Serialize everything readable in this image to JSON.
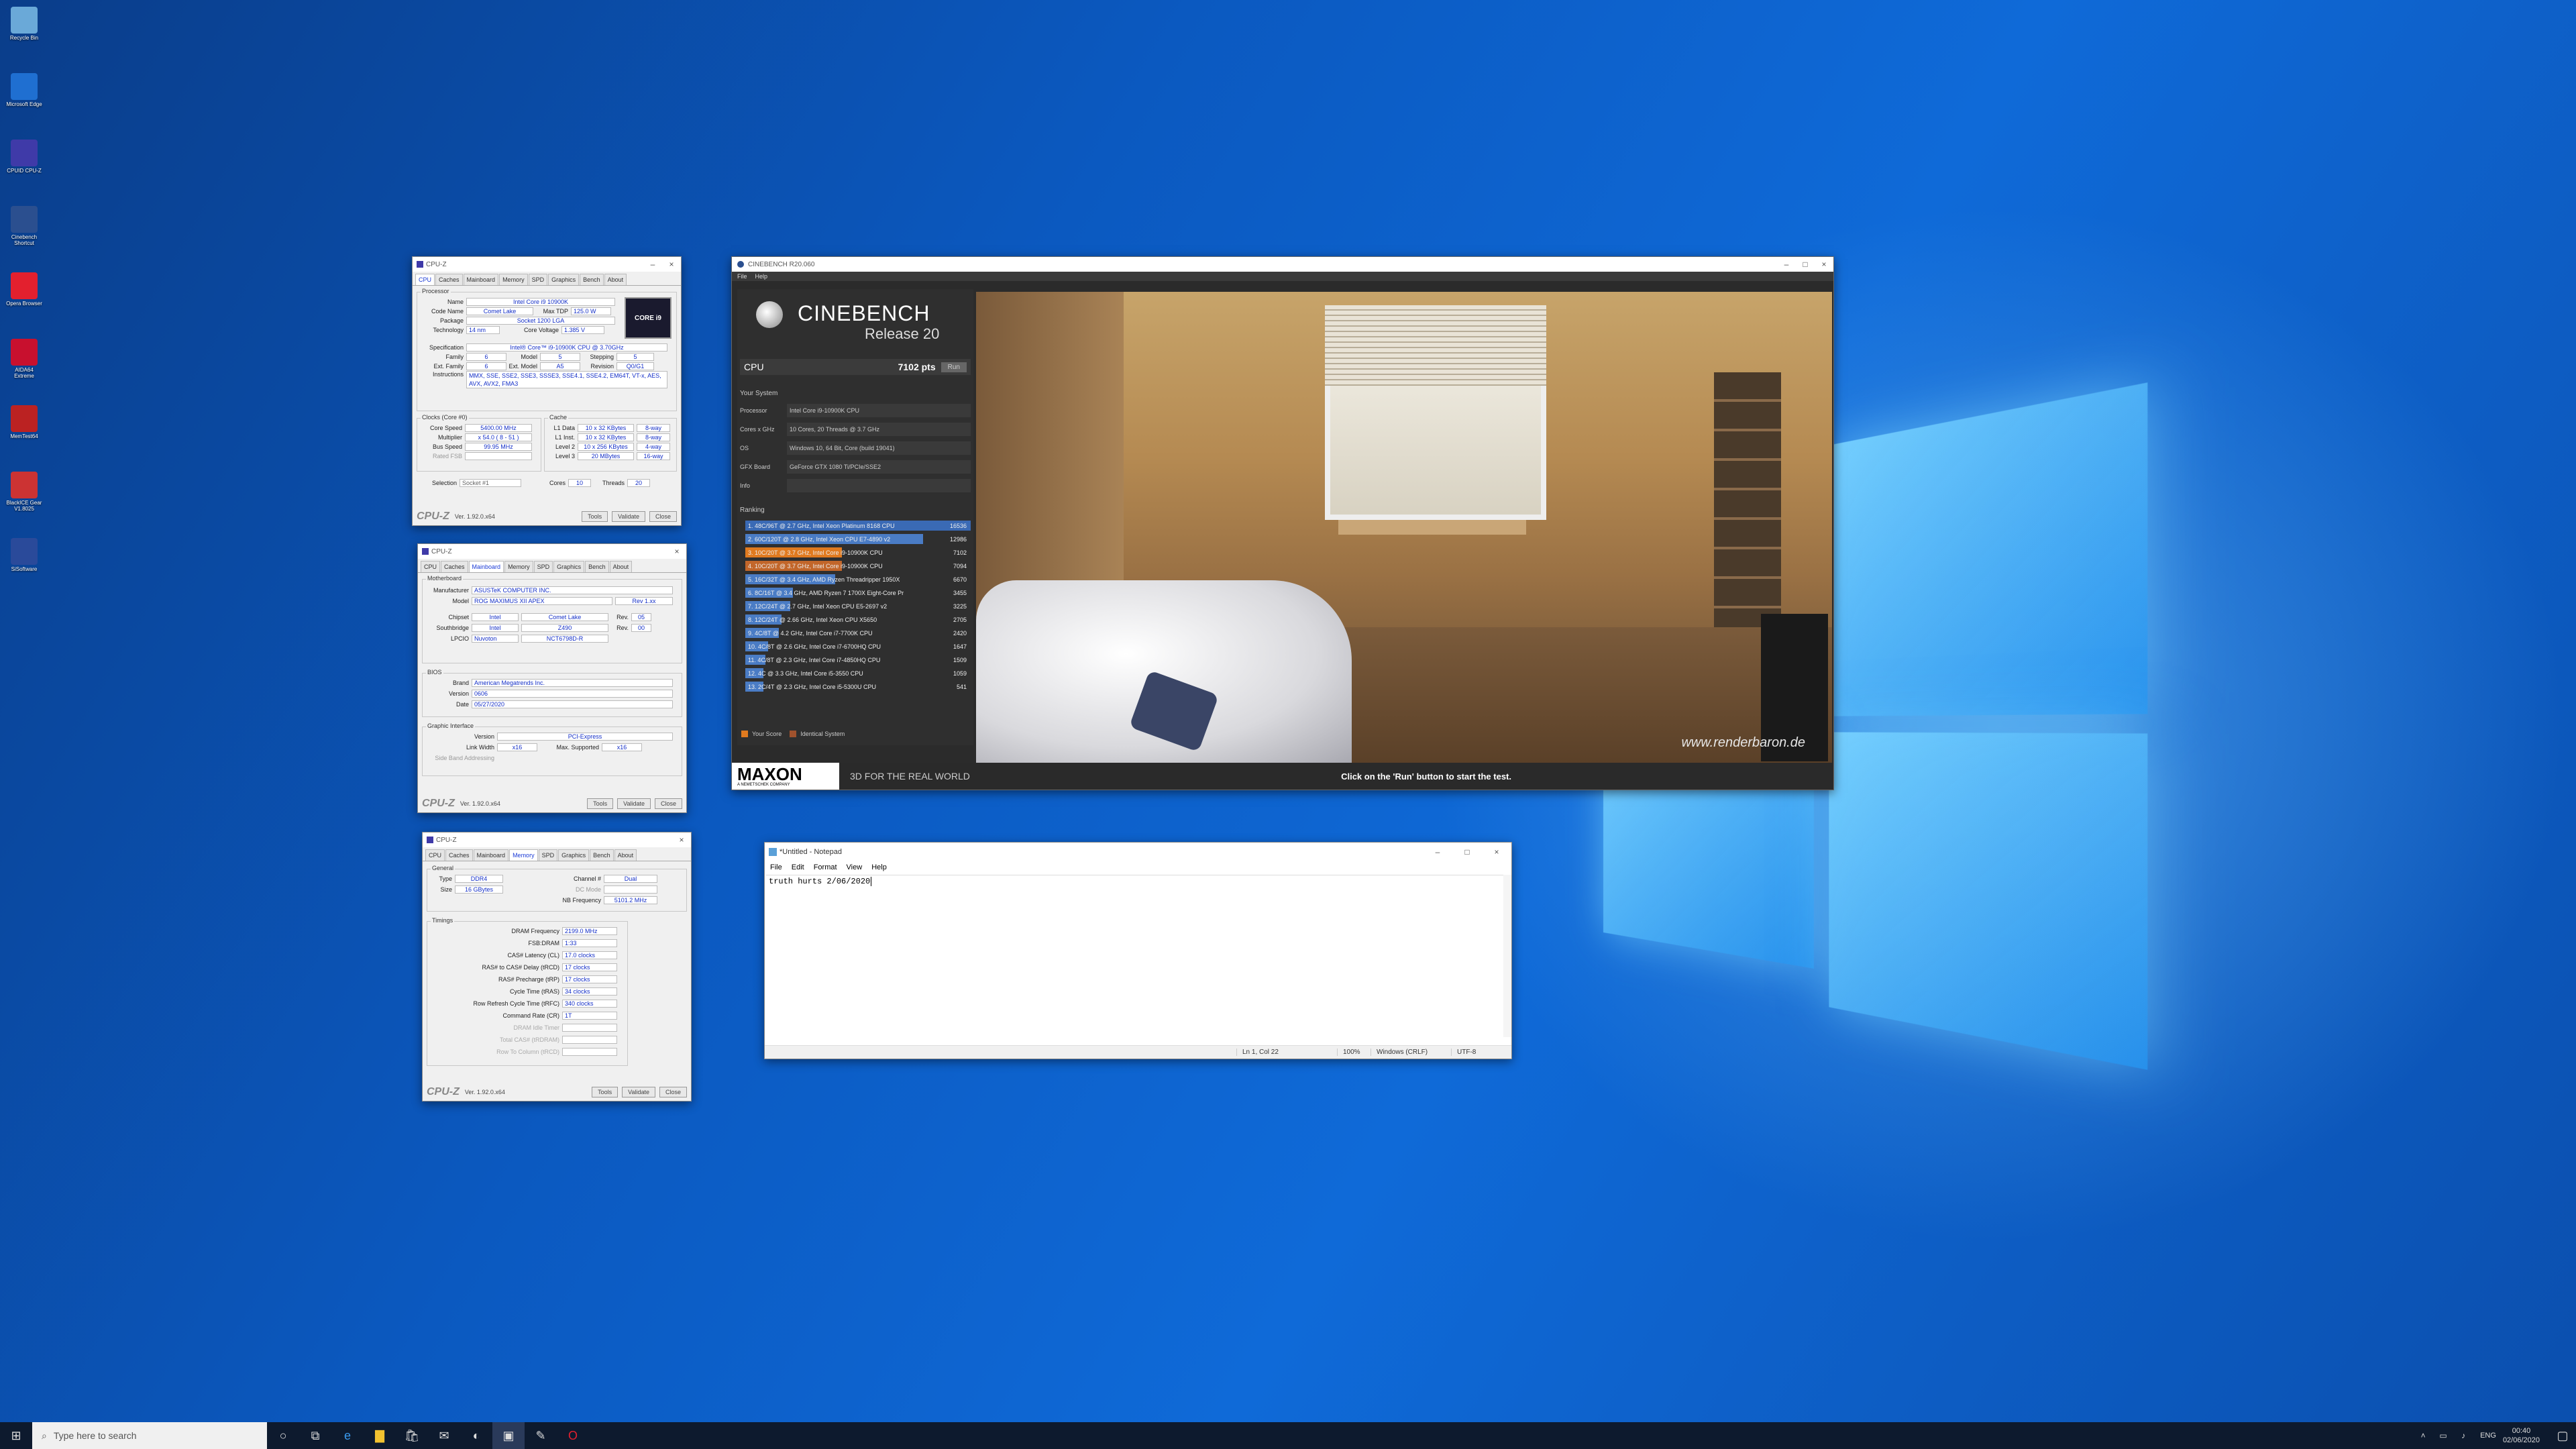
{
  "desktop_icons": [
    {
      "label": "Recycle Bin",
      "icon": "recycle-bin-icon",
      "color": "#6aa9d8"
    },
    {
      "label": "Microsoft Edge",
      "icon": "edge-icon",
      "color": "#1f6fd1"
    },
    {
      "label": "CPUID CPU-Z",
      "icon": "cpuz-icon",
      "color": "#3f3aa8"
    },
    {
      "label": "Cinebench Shortcut",
      "icon": "cinebench-icon",
      "color": "#2b4f8f"
    },
    {
      "label": "Opera Browser",
      "icon": "opera-icon",
      "color": "#e3202e"
    },
    {
      "label": "AIDA64 Extreme",
      "icon": "aida64-icon",
      "color": "#c8102e"
    },
    {
      "label": "MemTest64",
      "icon": "memtest-icon",
      "color": "#b22"
    },
    {
      "label": "BlackICE Gear V1.8025",
      "icon": "blackice-icon",
      "color": "#c33"
    },
    {
      "label": "SiSoftware",
      "icon": "sisoftware-icon",
      "color": "#2a4a9a"
    }
  ],
  "cpuz_cpu": {
    "title": "CPU-Z",
    "tabs": [
      "CPU",
      "Caches",
      "Mainboard",
      "Memory",
      "SPD",
      "Graphics",
      "Bench",
      "About"
    ],
    "processor_label": "Processor",
    "name_lbl": "Name",
    "name": "Intel Core i9 10900K",
    "codename_lbl": "Code Name",
    "codename": "Comet Lake",
    "maxtdp_lbl": "Max TDP",
    "maxtdp": "125.0 W",
    "package_lbl": "Package",
    "package": "Socket 1200 LGA",
    "tech_lbl": "Technology",
    "tech": "14 nm",
    "cv_lbl": "Core Voltage",
    "cv": "1.385 V",
    "spec_lbl": "Specification",
    "spec": "Intel® Core™ i9-10900K CPU @ 3.70GHz",
    "family_lbl": "Family",
    "family": "6",
    "model_lbl": "Model",
    "model": "5",
    "stepping_lbl": "Stepping",
    "stepping": "5",
    "extfam_lbl": "Ext. Family",
    "extfam": "6",
    "extmod_lbl": "Ext. Model",
    "extmod": "A5",
    "rev_lbl": "Revision",
    "rev": "Q0/G1",
    "instr_lbl": "Instructions",
    "instr": "MMX, SSE, SSE2, SSE3, SSSE3, SSE4.1, SSE4.2, EM64T, VT-x, AES, AVX, AVX2, FMA3",
    "clocks_label": "Clocks (Core #0)",
    "cache_label": "Cache",
    "cs_lbl": "Core Speed",
    "cs": "5400.00 MHz",
    "mul_lbl": "Multiplier",
    "mul": "x 54.0 ( 8 - 51 )",
    "bus_lbl": "Bus Speed",
    "bus": "99.95 MHz",
    "fsb_lbl": "Rated FSB",
    "l1d_lbl": "L1 Data",
    "l1d": "10 x 32 KBytes",
    "l1d_w": "8-way",
    "l1i_lbl": "L1 Inst.",
    "l1i": "10 x 32 KBytes",
    "l1i_w": "8-way",
    "l2_lbl": "Level 2",
    "l2": "10 x 256 KBytes",
    "l2_w": "4-way",
    "l3_lbl": "Level 3",
    "l3": "20 MBytes",
    "l3_w": "16-way",
    "sel_lbl": "Selection",
    "sel": "Socket #1",
    "cores_lbl": "Cores",
    "cores": "10",
    "threads_lbl": "Threads",
    "threads": "20",
    "logo_badge": "CORE i9"
  },
  "cpuz_common": {
    "logo": "CPU-Z",
    "version": "Ver. 1.92.0.x64",
    "tools": "Tools",
    "validate": "Validate",
    "close": "Close"
  },
  "cpuz_mb": {
    "title": "CPU-Z",
    "mb_label": "Motherboard",
    "man_lbl": "Manufacturer",
    "man": "ASUSTeK COMPUTER INC.",
    "model_lbl": "Model",
    "model": "ROG MAXIMUS XII APEX",
    "model_rev": "Rev 1.xx",
    "chip_lbl": "Chipset",
    "chip_v": "Intel",
    "chip": "Comet Lake",
    "chip_rev_lbl": "Rev.",
    "chip_rev": "05",
    "sb_lbl": "Southbridge",
    "sb_v": "Intel",
    "sb": "Z490",
    "sb_rev_lbl": "Rev.",
    "sb_rev": "00",
    "lpc_lbl": "LPCIO",
    "lpc_v": "Nuvoton",
    "lpc": "NCT6798D-R",
    "bios_label": "BIOS",
    "brand_lbl": "Brand",
    "brand": "American Megatrends Inc.",
    "ver_lbl": "Version",
    "ver": "0606",
    "date_lbl": "Date",
    "date": "05/27/2020",
    "gi_label": "Graphic Interface",
    "giv_lbl": "Version",
    "giv": "PCI-Express",
    "lw_lbl": "Link Width",
    "lw": "x16",
    "ms_lbl": "Max. Supported",
    "ms": "x16",
    "sba_lbl": "Side Band Addressing"
  },
  "cpuz_mem": {
    "title": "CPU-Z",
    "gen_label": "General",
    "type_lbl": "Type",
    "type": "DDR4",
    "ch_lbl": "Channel #",
    "ch": "Dual",
    "size_lbl": "Size",
    "size": "16 GBytes",
    "dc_lbl": "DC Mode",
    "nb_lbl": "NB Frequency",
    "nb": "5101.2 MHz",
    "tim_label": "Timings",
    "timings": [
      {
        "l": "DRAM Frequency",
        "v": "2199.0 MHz"
      },
      {
        "l": "FSB:DRAM",
        "v": "1:33"
      },
      {
        "l": "CAS# Latency (CL)",
        "v": "17.0 clocks"
      },
      {
        "l": "RAS# to CAS# Delay (tRCD)",
        "v": "17 clocks"
      },
      {
        "l": "RAS# Precharge (tRP)",
        "v": "17 clocks"
      },
      {
        "l": "Cycle Time (tRAS)",
        "v": "34 clocks"
      },
      {
        "l": "Row Refresh Cycle Time (tRFC)",
        "v": "340 clocks"
      },
      {
        "l": "Command Rate (CR)",
        "v": "1T"
      },
      {
        "l": "DRAM Idle Timer",
        "v": ""
      },
      {
        "l": "Total CAS# (tRDRAM)",
        "v": ""
      },
      {
        "l": "Row To Column (tRCD)",
        "v": ""
      }
    ]
  },
  "cinebench": {
    "title": "CINEBENCH R20.060",
    "menu": [
      "File",
      "Help"
    ],
    "brand": "CINEBENCH",
    "release": "Release 20",
    "cpu_lbl": "CPU",
    "cpu_score": "7102 pts",
    "run": "Run",
    "your_system": "Your System",
    "sys": [
      {
        "k": "Processor",
        "v": "Intel Core i9-10900K CPU"
      },
      {
        "k": "Cores x GHz",
        "v": "10 Cores, 20 Threads @ 3.7 GHz"
      },
      {
        "k": "OS",
        "v": "Windows 10, 64 Bit, Core (build 19041)"
      },
      {
        "k": "GFX Board",
        "v": "GeForce GTX 1080 Ti/PCIe/SSE2"
      },
      {
        "k": "Info",
        "v": ""
      }
    ],
    "ranking": "Ranking",
    "ranks": [
      {
        "t": "1. 48C/96T @ 2.7 GHz, Intel Xeon Platinum 8168 CPU",
        "s": "16536",
        "c": "#3a6ab5",
        "w": 100
      },
      {
        "t": "2. 60C/120T @ 2.8 GHz, Intel Xeon CPU E7-4890 v2",
        "s": "12986",
        "c": "#4a7cc5",
        "w": 79
      },
      {
        "t": "3. 10C/20T @ 3.7 GHz, Intel Core i9-10900K CPU",
        "s": "7102",
        "c": "#e07a1f",
        "w": 43
      },
      {
        "t": "4. 10C/20T @ 3.7 GHz, Intel Core i9-10900K CPU",
        "s": "7094",
        "c": "#c2662a",
        "w": 43
      },
      {
        "t": "5. 16C/32T @ 3.4 GHz, AMD Ryzen Threadripper 1950X",
        "s": "6670",
        "c": "#4a7cc5",
        "w": 40
      },
      {
        "t": "6. 8C/16T @ 3.4 GHz, AMD Ryzen 7 1700X Eight-Core Pr",
        "s": "3455",
        "c": "#4a7cc5",
        "w": 21
      },
      {
        "t": "7. 12C/24T @ 2.7 GHz, Intel Xeon CPU E5-2697 v2",
        "s": "3225",
        "c": "#4a7cc5",
        "w": 20
      },
      {
        "t": "8. 12C/24T @ 2.66 GHz, Intel Xeon CPU X5650",
        "s": "2705",
        "c": "#4a7cc5",
        "w": 16
      },
      {
        "t": "9. 4C/8T @ 4.2 GHz, Intel Core i7-7700K CPU",
        "s": "2420",
        "c": "#4a7cc5",
        "w": 15
      },
      {
        "t": "10. 4C/8T @ 2.6 GHz, Intel Core i7-6700HQ CPU",
        "s": "1647",
        "c": "#4a7cc5",
        "w": 10
      },
      {
        "t": "11. 4C/8T @ 2.3 GHz, Intel Core i7-4850HQ CPU",
        "s": "1509",
        "c": "#4a7cc5",
        "w": 9
      },
      {
        "t": "12. 4C @ 3.3 GHz, Intel Core i5-3550 CPU",
        "s": "1059",
        "c": "#4a7cc5",
        "w": 6
      },
      {
        "t": "13. 2C/4T @ 2.3 GHz, Intel Core i5-5300U CPU",
        "s": "541",
        "c": "#4a7cc5",
        "w": 3
      }
    ],
    "legend_your": "Your Score",
    "legend_ident": "Identical System",
    "maxon": "MAXON",
    "maxon_sub": "A NEMETSCHEK COMPANY",
    "tagline": "3D FOR THE REAL WORLD",
    "status": "Click on the 'Run' button to start the test.",
    "watermark": "www.renderbaron.de"
  },
  "notepad": {
    "title": "*Untitled - Notepad",
    "menu": [
      "File",
      "Edit",
      "Format",
      "View",
      "Help"
    ],
    "text": "truth hurts 2/06/2020",
    "status": {
      "pos": "Ln 1, Col 22",
      "zoom": "100%",
      "eol": "Windows (CRLF)",
      "enc": "UTF-8"
    }
  },
  "taskbar": {
    "search_placeholder": "Type here to search",
    "lang": "ENG",
    "time": "00:40",
    "date": "02/06/2020"
  }
}
